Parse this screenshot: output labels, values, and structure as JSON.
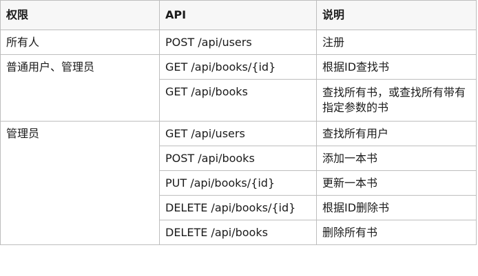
{
  "header": {
    "permission": "权限",
    "api": "API",
    "description": "说明"
  },
  "rows": [
    {
      "permission": "所有人",
      "api": "POST /api/users",
      "description": "注册"
    },
    {
      "permission": "普通用户、管理员",
      "api": "GET /api/books/{id}",
      "description": "根据ID查找书"
    },
    {
      "permission": "",
      "api": "GET /api/books",
      "description": "查找所有书，或查找所有带有指定参数的书"
    },
    {
      "permission": "管理员",
      "api": "GET /api/users",
      "description": "查找所有用户"
    },
    {
      "permission": "",
      "api": "POST /api/books",
      "description": "添加一本书"
    },
    {
      "permission": "",
      "api": "PUT /api/books/{id}",
      "description": "更新一本书"
    },
    {
      "permission": "",
      "api": "DELETE /api/books/{id}",
      "description": "根据ID删除书"
    },
    {
      "permission": "",
      "api": "DELETE /api/books",
      "description": "删除所有书"
    }
  ]
}
